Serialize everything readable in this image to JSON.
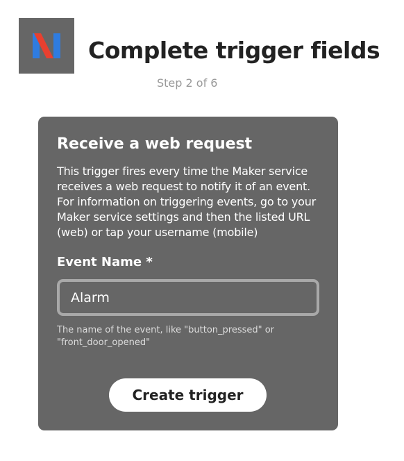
{
  "header": {
    "logo_icon": "maker-webhooks-logo",
    "logo_colors": {
      "tile": "#666666",
      "blue": "#2f7ce0",
      "red": "#e8402f"
    },
    "title": "Complete trigger fields",
    "step": "Step 2 of 6"
  },
  "trigger_card": {
    "title": "Receive a web request",
    "description": "This trigger fires every time the Maker service receives a web request to notify it of an event. For information on triggering events, go to your Maker service settings and then the listed URL (web) or tap your username (mobile)",
    "field": {
      "label": "Event Name *",
      "value": "Alarm",
      "help": "The name of the event, like \"button_pressed\" or \"front_door_opened\""
    },
    "submit_label": "Create trigger"
  }
}
